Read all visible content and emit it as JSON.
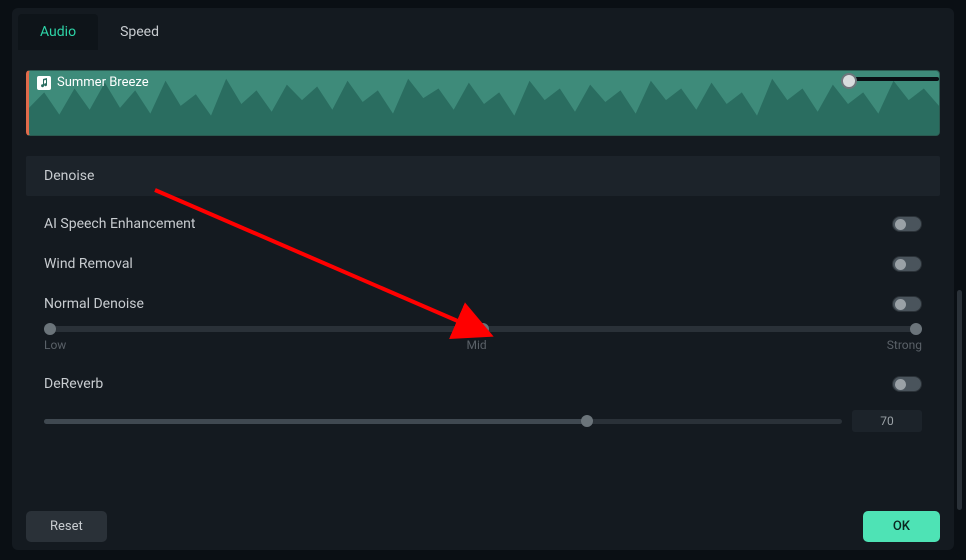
{
  "tabs": [
    {
      "label": "Audio",
      "active": true
    },
    {
      "label": "Speed",
      "active": false
    }
  ],
  "clip": {
    "title": "Summer Breeze"
  },
  "section": {
    "title": "Denoise"
  },
  "options": {
    "ai_speech": {
      "label": "AI Speech Enhancement",
      "on": false
    },
    "wind": {
      "label": "Wind Removal",
      "on": false
    },
    "normal": {
      "label": "Normal Denoise",
      "on": false,
      "slider": {
        "low": "Low",
        "mid": "Mid",
        "strong": "Strong",
        "position_pct": 50
      }
    },
    "dereverb": {
      "label": "DeReverb",
      "on": false,
      "value": "70",
      "position_pct": 68
    }
  },
  "footer": {
    "reset": "Reset",
    "ok": "OK"
  },
  "colors": {
    "accent": "#2dd4a7",
    "ok_bg": "#4ee3b5",
    "arrow": "#ff0000"
  }
}
